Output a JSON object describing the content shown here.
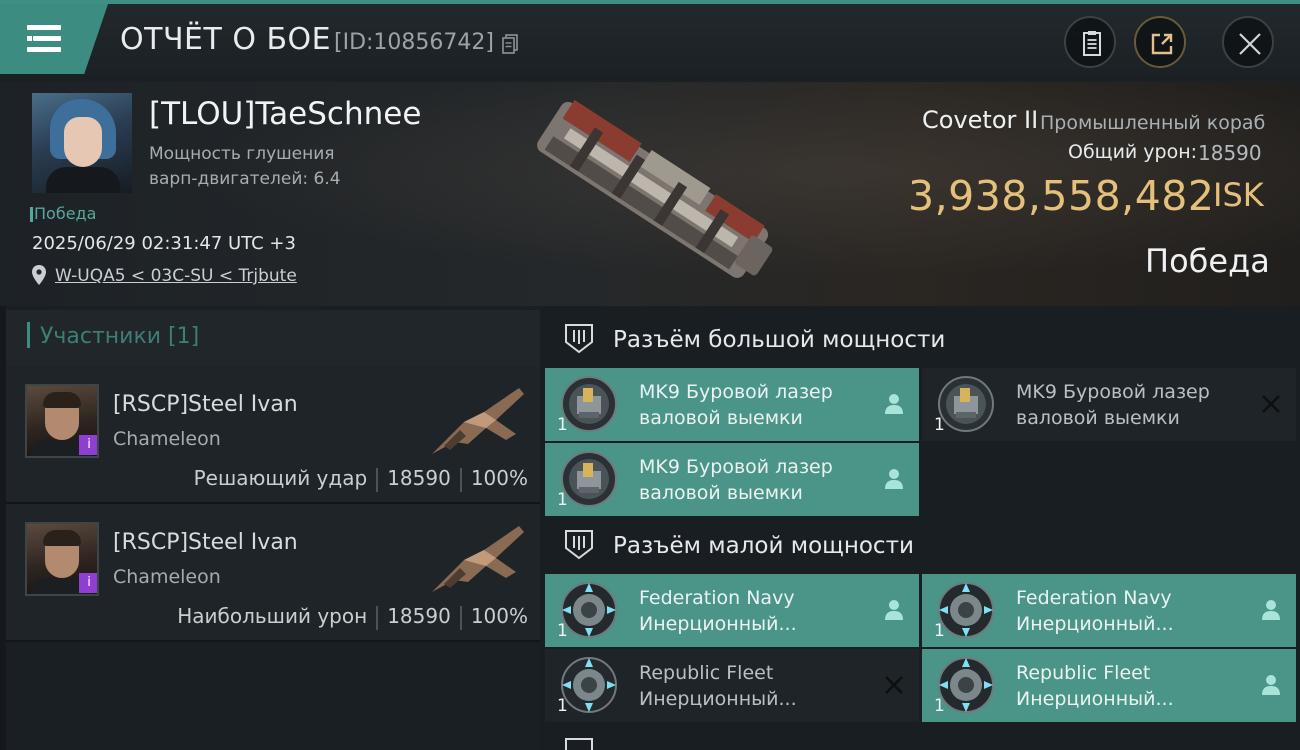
{
  "header": {
    "title": "ОТЧЁТ О БОЕ",
    "report_id": "[ID:10856742]"
  },
  "victim": {
    "name": "[TLOU]TaeSchnee",
    "stat_line1": "Мощность глушения",
    "stat_line2": "варп-двигателей: 6.4",
    "result": "Победа",
    "datetime": "2025/06/29 02:31:47 UTC +3",
    "location": "W-UQA5 < 03C-SU < Trjbute",
    "ship_name": "Covetor II",
    "ship_class": "Промышленный корабль",
    "total_damage_label": "Общий урон:",
    "total_damage": "18590",
    "isk_value": "3,938,558,482",
    "isk_unit": "ISK",
    "outcome": "Победа"
  },
  "participants": {
    "title": "Участники [1]",
    "items": [
      {
        "name": "[RSCP]Steel Ivan",
        "ship": "Chameleon",
        "role": "Решающий удар",
        "damage": "18590",
        "percent": "100%",
        "badge": "i"
      },
      {
        "name": "[RSCP]Steel Ivan",
        "ship": "Chameleon",
        "role": "Наибольший урон",
        "damage": "18590",
        "percent": "100%",
        "badge": "i"
      }
    ]
  },
  "fitting": {
    "high_slot_title": "Разъём большой мощности",
    "low_slot_title": "Разъём малой мощности",
    "modules": [
      {
        "qty": "1",
        "line1": "MK9 Буровой лазер",
        "line2": "валовой выемки",
        "status": "dropped"
      },
      {
        "qty": "1",
        "line1": "MK9 Буровой лазер",
        "line2": "валовой выемки",
        "status": "destroyed"
      },
      {
        "qty": "1",
        "line1": "MK9 Буровой лазер",
        "line2": "валовой выемки",
        "status": "dropped"
      },
      {
        "qty": "1",
        "line1": "Federation Navy",
        "line2": "Инерционный...",
        "status": "dropped"
      },
      {
        "qty": "1",
        "line1": "Federation Navy",
        "line2": "Инерционный...",
        "status": "dropped"
      },
      {
        "qty": "1",
        "line1": "Republic Fleet",
        "line2": "Инерционный...",
        "status": "destroyed"
      },
      {
        "qty": "1",
        "line1": "Republic Fleet",
        "line2": "Инерционный...",
        "status": "dropped"
      }
    ]
  },
  "colors": {
    "accent": "#3d8c82",
    "isk": "#e4c07a",
    "module_dropped": "#4b9488",
    "module_destroyed": "#1f2428"
  },
  "icons": [
    "menu-icon",
    "copy-icon",
    "clipboard-icon",
    "share-icon",
    "close-icon",
    "location-pin-icon",
    "high-slot-icon",
    "low-slot-icon",
    "mining-laser-icon",
    "inertial-stabilizer-icon",
    "person-icon",
    "x-mark-icon"
  ]
}
